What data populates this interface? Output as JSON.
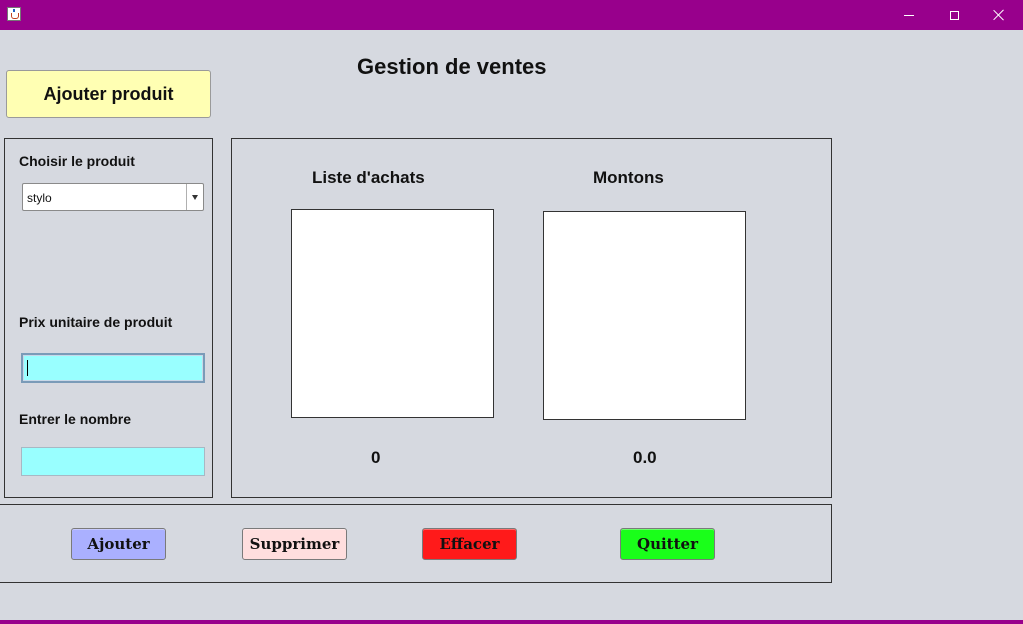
{
  "window": {
    "title": "",
    "titlebar_color": "#98008c",
    "controls": {
      "minimize": "minimize-icon",
      "maximize": "maximize-icon",
      "close": "close-icon"
    }
  },
  "header": {
    "title": "Gestion de ventes",
    "add_product_label": "Ajouter produit",
    "add_product_color": "#ffffb3"
  },
  "left_panel": {
    "choose_label": "Choisir le produit",
    "product_select": {
      "selected": "stylo"
    },
    "price_label": "Prix unitaire de produit",
    "price_value": "",
    "quantity_label": "Entrer le nombre",
    "quantity_value": "",
    "field_color": "#99ffff"
  },
  "center_panel": {
    "purchases_title": "Liste d'achats",
    "amounts_title": "Montons",
    "purchases_items": [],
    "amounts_items": [],
    "purchases_total": "0",
    "amounts_total": "0.0"
  },
  "actions": {
    "add": {
      "label": "Ajouter",
      "color": "#aab0ff"
    },
    "delete": {
      "label": "Supprimer",
      "color": "#ffdede"
    },
    "clear": {
      "label": "Effacer",
      "color": "#ff1a1a"
    },
    "quit": {
      "label": "Quitter",
      "color": "#1aff1a"
    }
  }
}
